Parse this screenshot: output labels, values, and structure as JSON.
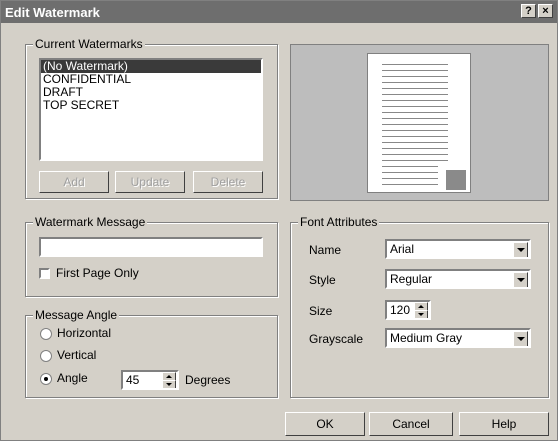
{
  "window": {
    "title": "Edit Watermark",
    "help_btn": "?",
    "close_btn": "×"
  },
  "current_watermarks": {
    "label": "Current Watermarks",
    "items": [
      "(No Watermark)",
      "CONFIDENTIAL",
      "DRAFT",
      "TOP SECRET"
    ],
    "selected_index": 0,
    "add": "Add",
    "update": "Update",
    "delete": "Delete"
  },
  "watermark_message": {
    "label": "Watermark Message",
    "value": "",
    "first_page_only": "First Page Only",
    "first_page_checked": false
  },
  "message_angle": {
    "label": "Message Angle",
    "horizontal": "Horizontal",
    "vertical": "Vertical",
    "angle": "Angle",
    "selected": "angle",
    "angle_value": "45",
    "degrees": "Degrees"
  },
  "font_attributes": {
    "label": "Font Attributes",
    "name_label": "Name",
    "name_value": "Arial",
    "style_label": "Style",
    "style_value": "Regular",
    "size_label": "Size",
    "size_value": "120",
    "grayscale_label": "Grayscale",
    "grayscale_value": "Medium Gray"
  },
  "buttons": {
    "ok": "OK",
    "cancel": "Cancel",
    "help": "Help"
  },
  "icons": [
    "help-icon",
    "close-icon",
    "dropdown-arrow-icon",
    "spin-up-icon",
    "spin-down-icon"
  ]
}
